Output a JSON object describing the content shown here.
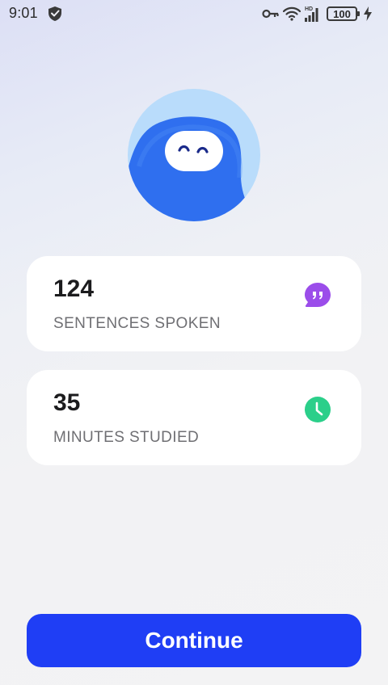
{
  "status_bar": {
    "time": "9:01",
    "battery_level": "100",
    "icons": [
      "shield-icon",
      "vpn-key-icon",
      "wifi-icon",
      "cellular-signal-icon",
      "battery-icon",
      "charging-icon"
    ],
    "signal_badge": "HD"
  },
  "mascot": {
    "icon": "smiling-mascot-avatar",
    "colors": {
      "background": "#b9dcfb",
      "body": "#2f6fef",
      "face": "#ffffff",
      "eyes": "#1a2a8a"
    }
  },
  "stats": [
    {
      "value": "124",
      "label": "SENTENCES SPOKEN",
      "icon": "speech-bubble-quote-icon",
      "icon_color": "#9b4dea"
    },
    {
      "value": "35",
      "label": "MINUTES STUDIED",
      "icon": "clock-icon",
      "icon_color": "#2bcf8a"
    }
  ],
  "continue_button": {
    "label": "Continue",
    "color": "#1f3ef5"
  }
}
